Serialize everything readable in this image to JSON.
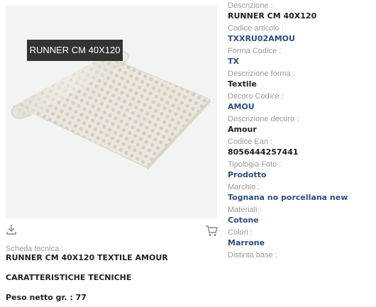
{
  "product_image": {
    "tag_label": "RUNNER CM 40X120"
  },
  "details": [
    {
      "label": "Descrizione :",
      "value": "RUNNER CM 40X120",
      "style": "dark"
    },
    {
      "label": "Codice articolo :",
      "value": "TXXRU02AMOU",
      "style": "blue"
    },
    {
      "label": "Forma Codice :",
      "value": "TX",
      "style": "blue"
    },
    {
      "label": "Descrizione forma :",
      "value": "Textile",
      "style": "dark"
    },
    {
      "label": "Decoro Codice :",
      "value": "AMOU",
      "style": "blue"
    },
    {
      "label": "Descrizione decoro :",
      "value": "Amour",
      "style": "dark"
    },
    {
      "label": "Codice Ean :",
      "value": "8056444257441",
      "style": "dark"
    },
    {
      "label": "Tipologia Foto :",
      "value": "Prodotto",
      "style": "blue"
    },
    {
      "label": "Marchio :",
      "value": "Tognana no porcellana new",
      "style": "blue"
    },
    {
      "label": "Materiali :",
      "value": "Cotone",
      "style": "blue"
    },
    {
      "label": "Colori :",
      "value": "Marrone",
      "style": "blue"
    },
    {
      "label": "Distinta base :",
      "value": "",
      "style": "dark"
    }
  ],
  "scheda": {
    "label": "Scheda tecnica :",
    "value": "RUNNER CM 40X120 TEXTILE AMOUR",
    "characteristics_title": "CARATTERISTICHE TECNICHE",
    "peso": "Peso netto gr. : 77"
  },
  "icons": {
    "download": "download-icon",
    "cart": "cart-icon"
  },
  "colors": {
    "label_gray": "#9a9a9a",
    "value_dark": "#222222",
    "value_blue": "#2e4e7e",
    "tag_bg": "#333333",
    "image_bg": "#f3f3f3",
    "fabric": "#ece8de"
  }
}
